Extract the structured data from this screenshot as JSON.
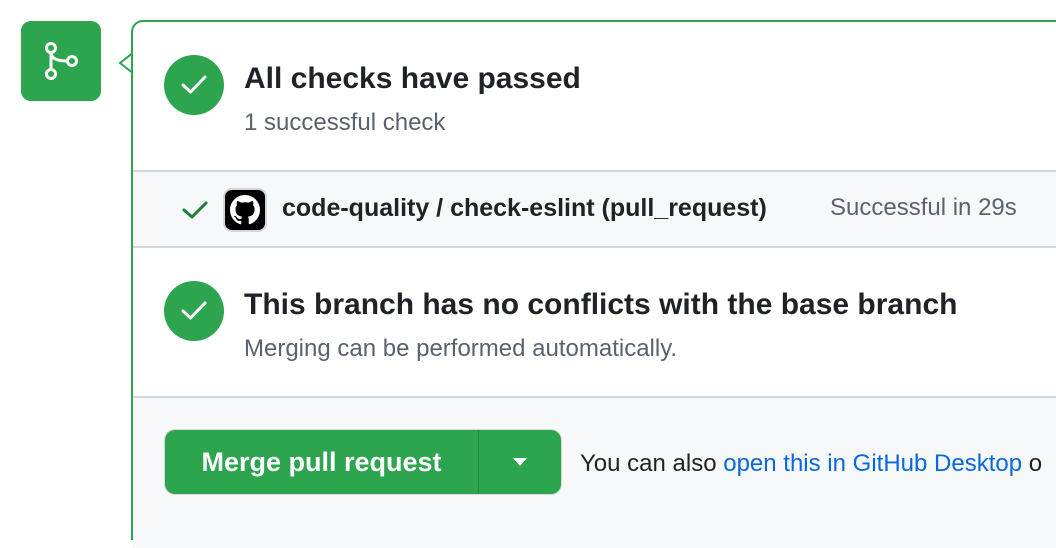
{
  "icons": {
    "merge_badge": "git-merge-icon",
    "status_check": "check-icon",
    "avatar": "github-logo-icon",
    "dropdown": "triangle-down-icon"
  },
  "colors": {
    "success": "#2da44e",
    "link": "#0969da",
    "muted": "#59636e",
    "border": "#d0d7de"
  },
  "checks": {
    "title": "All checks have passed",
    "subtitle": "1 successful check",
    "items": [
      {
        "name": "code-quality / check-eslint (pull_request)",
        "status": "Successful in 29s"
      }
    ]
  },
  "conflicts": {
    "title": "This branch has no conflicts with the base branch",
    "subtitle": "Merging can be performed automatically."
  },
  "merge": {
    "button_label": "Merge pull request",
    "also_prefix": "You can also ",
    "desktop_link": "open this in GitHub Desktop",
    "also_suffix": " o"
  }
}
